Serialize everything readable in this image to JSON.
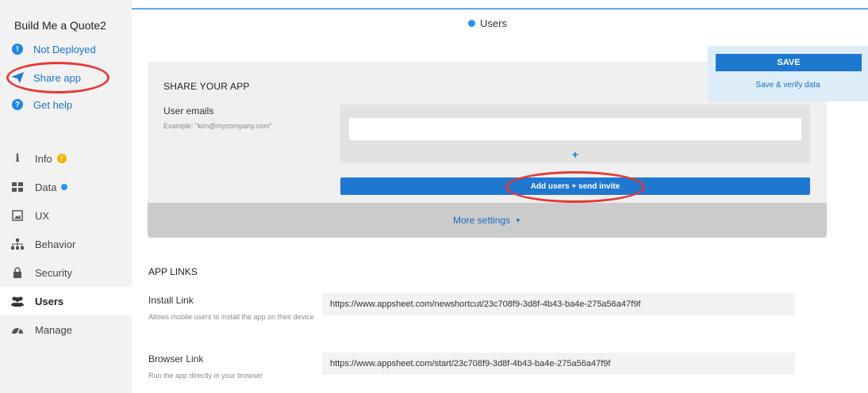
{
  "sidebar": {
    "app_title": "Build Me a Quote2",
    "status_items": [
      {
        "label": "Not Deployed",
        "icon": "exclamation-circle-icon"
      },
      {
        "label": "Share app",
        "icon": "paper-plane-icon"
      },
      {
        "label": "Get help",
        "icon": "question-circle-icon"
      }
    ],
    "nav_items": [
      {
        "label": "Info",
        "icon": "info-icon",
        "badge": "warning"
      },
      {
        "label": "Data",
        "icon": "grid-icon",
        "badge": "dot"
      },
      {
        "label": "UX",
        "icon": "image-icon"
      },
      {
        "label": "Behavior",
        "icon": "hierarchy-icon"
      },
      {
        "label": "Security",
        "icon": "lock-icon"
      },
      {
        "label": "Users",
        "icon": "users-icon",
        "active": true
      },
      {
        "label": "Manage",
        "icon": "dashboard-icon"
      }
    ]
  },
  "header": {
    "tab_label": "Users"
  },
  "save_panel": {
    "save_label": "SAVE",
    "verify_label": "Save & verify data"
  },
  "share": {
    "heading": "SHARE YOUR APP",
    "emails_label": "User emails",
    "emails_hint": "Example: \"kim@mycompany.com\"",
    "email_value": "",
    "add_label": "+",
    "invite_label": "Add users + send invite",
    "more_settings_label": "More settings"
  },
  "app_links": {
    "heading": "APP LINKS",
    "install": {
      "label": "Install Link",
      "hint": "Allows mobile users to install the app on their device",
      "url": "https://www.appsheet.com/newshortcut/23c708f9-3d8f-4b43-ba4e-275a56a47f9f"
    },
    "browser": {
      "label": "Browser Link",
      "hint": "Run the app directly in your browser",
      "url": "https://www.appsheet.com/start/23c708f9-3d8f-4b43-ba4e-275a56a47f9f"
    }
  },
  "colors": {
    "accent": "#1e78d0",
    "annotation": "#e53935",
    "warning": "#f5b400"
  }
}
